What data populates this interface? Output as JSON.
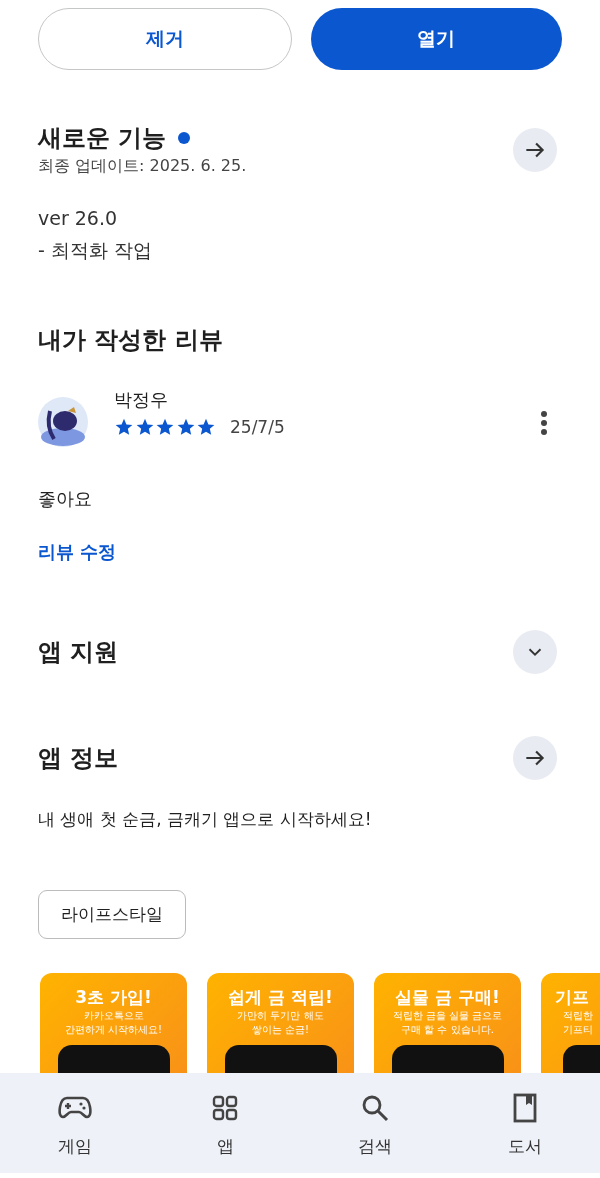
{
  "actions": [
    {
      "label": "제거",
      "kind": "outline"
    },
    {
      "label": "열기",
      "kind": "filled"
    }
  ],
  "whats_new": {
    "title": "새로운 기능",
    "new_dot": true,
    "updated": "최종 업데이트: 2025. 6. 25.",
    "notes": [
      "ver 26.0",
      "- 최적화 작업"
    ]
  },
  "my_review": {
    "title": "내가 작성한 리뷰",
    "author": "박정우",
    "stars": 5,
    "date": "25/7/5",
    "text": "좋아요",
    "edit_link": "리뷰 수정"
  },
  "app_support": {
    "title": "앱 지원",
    "expanded": false
  },
  "app_info": {
    "title": "앱 정보",
    "description": "내 생애 첫 순금, 금캐기 앱으로 시작하세요!",
    "category": "라이프스타일"
  },
  "screenshots": [
    {
      "title": "3초 가입!",
      "lines": [
        "카카오톡으로",
        "간편하게 시작하세요!"
      ]
    },
    {
      "title": "쉽게 금 적립!",
      "lines": [
        "가만히 두기만 해도",
        "쌓이는 순금!"
      ]
    },
    {
      "title": "실물 금 구매!",
      "lines": [
        "적립한 금을 실물 금으로",
        "구매 할 수 있습니다."
      ]
    },
    {
      "title": "기프",
      "lines": [
        "적립한",
        "기프티"
      ]
    }
  ],
  "bottom_nav": [
    {
      "label": "게임",
      "kind": "games",
      "selected": false
    },
    {
      "label": "앱",
      "kind": "apps",
      "selected": false
    },
    {
      "label": "검색",
      "kind": "search",
      "selected": false
    },
    {
      "label": "도서",
      "kind": "books",
      "selected": false
    }
  ]
}
